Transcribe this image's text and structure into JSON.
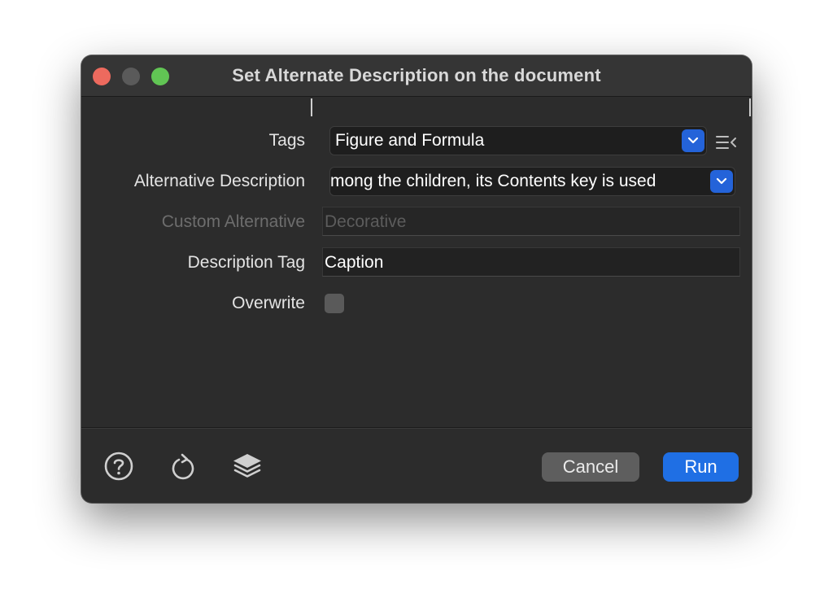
{
  "window": {
    "title": "Set Alternate Description on the document"
  },
  "form": {
    "tags": {
      "label": "Tags",
      "value": "Figure and Formula"
    },
    "alt_description": {
      "label": "Alternative Description",
      "value": "mong the children, its Contents key is used"
    },
    "custom_alternative": {
      "label": "Custom Alternative",
      "placeholder": "Decorative"
    },
    "description_tag": {
      "label": "Description Tag",
      "value": "Caption"
    },
    "overwrite": {
      "label": "Overwrite",
      "checked": false
    }
  },
  "footer": {
    "icons": [
      "help-icon",
      "reset-icon",
      "layers-icon"
    ],
    "cancel_label": "Cancel",
    "run_label": "Run"
  },
  "colors": {
    "accent": "#1f6fe4",
    "close": "#ed6a5e",
    "zoom": "#61c554"
  }
}
